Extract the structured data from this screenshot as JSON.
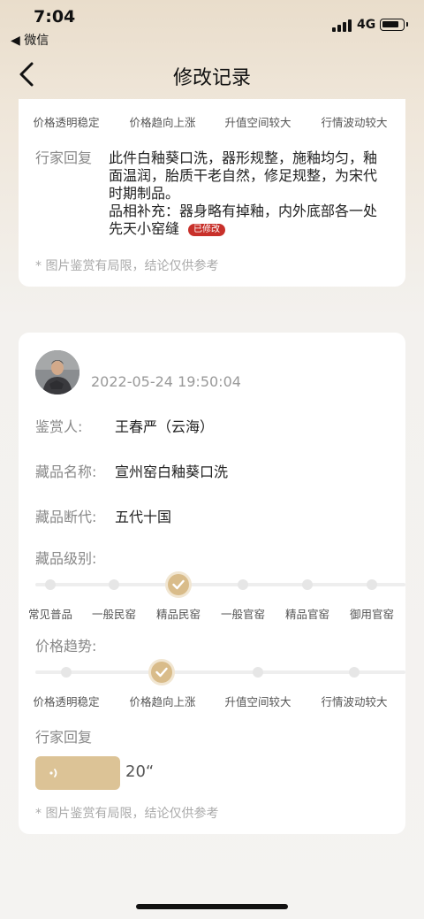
{
  "status_bar": {
    "time": "7:04",
    "back_app": "◀ 微信",
    "network": "4G"
  },
  "nav": {
    "title": "修改记录"
  },
  "card1": {
    "price_trend_options": [
      "价格透明稳定",
      "价格趋向上涨",
      "升值空间较大",
      "行情波动较大"
    ],
    "reply_label": "行家回复",
    "reply_lines": [
      "此件白釉葵口洗，器形规整，施釉均匀，釉",
      "面温润，胎质干老自然，修足规整，为宋代",
      "时期制品。",
      "品相补充：器身略有掉釉，内外底部各一处",
      "先天小窑缝"
    ],
    "modified_badge": "已修改",
    "disclaimer": "* 图片鉴赏有局限，结论仅供参考"
  },
  "card2": {
    "timestamp": "2022-05-24 19:50:04",
    "appraiser_label": "鉴赏人:",
    "appraiser_value": "王春严（云海）",
    "item_name_label": "藏品名称:",
    "item_name_value": "宣州窑白釉葵口洗",
    "dynasty_label": "藏品断代:",
    "dynasty_value": "五代十国",
    "grade_label": "藏品级别:",
    "grade_options": [
      "常见普品",
      "一般民窑",
      "精品民窑",
      "一般官窑",
      "精品官窑",
      "御用官窑"
    ],
    "grade_selected_index": 2,
    "price_label": "价格趋势:",
    "price_options": [
      "价格透明稳定",
      "价格趋向上涨",
      "升值空间较大",
      "行情波动较大"
    ],
    "price_selected_index": 1,
    "reply_label": "行家回复",
    "audio_duration": "20“",
    "disclaimer": "* 图片鉴赏有局限，结论仅供参考"
  },
  "colors": {
    "accent": "#d9bc8a",
    "badge": "#c8302a",
    "audio": "#dcc396"
  }
}
